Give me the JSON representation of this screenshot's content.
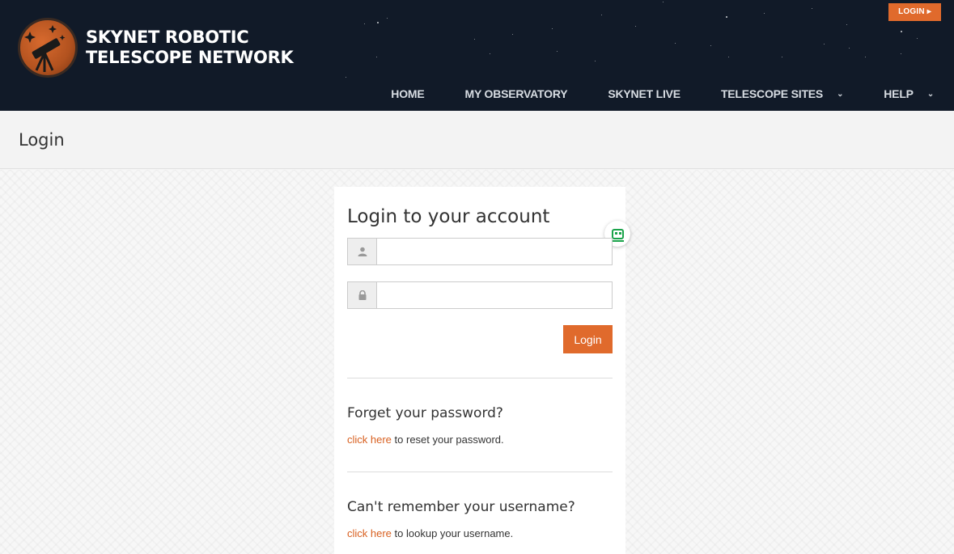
{
  "header": {
    "logo_line1": "SKYNET ROBOTIC",
    "logo_line2": "TELESCOPE NETWORK",
    "login_button": "LOGIN ▸",
    "nav": [
      {
        "label": "HOME"
      },
      {
        "label": "MY OBSERVATORY"
      },
      {
        "label": "SKYNET LIVE"
      },
      {
        "label": "TELESCOPE SITES",
        "has_dropdown": true
      },
      {
        "label": "HELP",
        "has_dropdown": true
      }
    ],
    "caret": "⌄"
  },
  "titlebar": {
    "title": "Login"
  },
  "card": {
    "heading": "Login to your account",
    "username": {
      "value": "",
      "placeholder": "",
      "icon": "user-icon"
    },
    "password": {
      "value": "",
      "placeholder": "",
      "icon": "lock-icon"
    },
    "submit_label": "Login",
    "forgot_password": {
      "heading": "Forget your password?",
      "link": "click here",
      "text": " to reset your password."
    },
    "forgot_username": {
      "heading": "Can't remember your username?",
      "link": "click here",
      "text": " to lookup your username."
    }
  },
  "colors": {
    "accent": "#e06a2c",
    "header_bg": "#111a28",
    "link": "#d85f1f"
  }
}
